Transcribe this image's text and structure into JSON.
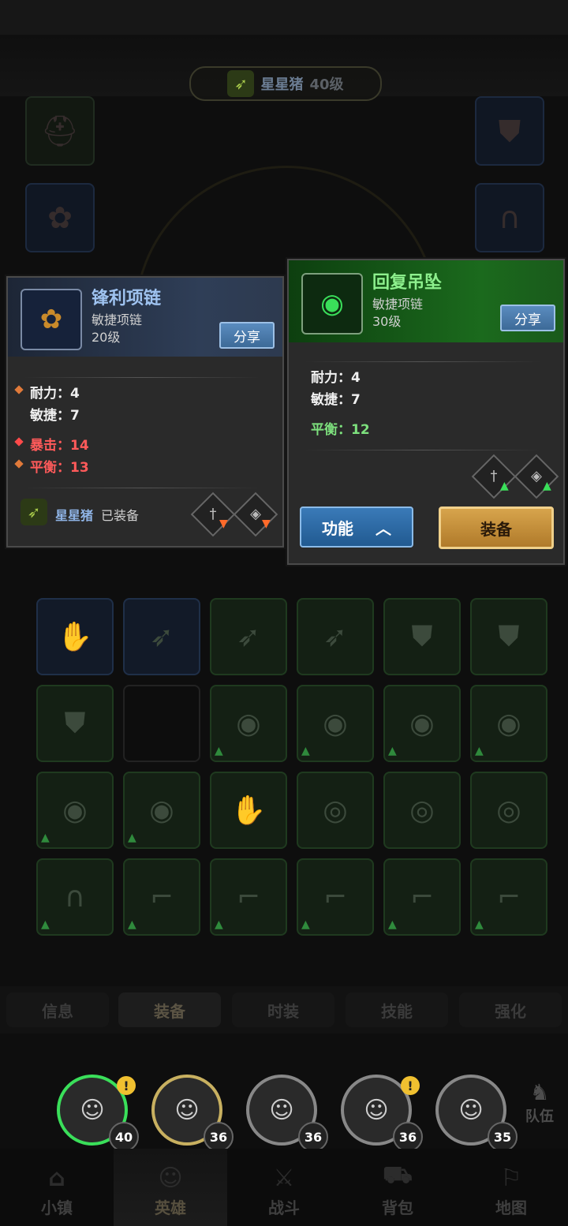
{
  "hero": {
    "name": "星星猪",
    "level": "40级"
  },
  "equipped_item": {
    "name": "锋利项链",
    "type": "敏捷项链",
    "level": "20级",
    "share_label": "分享",
    "stats": [
      {
        "label": "耐力：4"
      },
      {
        "label": "敏捷：7"
      }
    ],
    "bonus_stats": [
      {
        "label": "暴击：14"
      },
      {
        "label": "平衡：13"
      }
    ],
    "equipped_by": "星星猪",
    "equipped_status": "已装备"
  },
  "selected_item": {
    "name": "回复吊坠",
    "type": "敏捷项链",
    "level": "30级",
    "share_label": "分享",
    "stats": [
      {
        "label": "耐力：4"
      },
      {
        "label": "敏捷：7"
      }
    ],
    "bonus_stats": [
      {
        "label": "平衡：12"
      }
    ],
    "function_label": "功能",
    "equip_label": "装备"
  },
  "tabs": [
    {
      "label": "信息"
    },
    {
      "label": "装备"
    },
    {
      "label": "时装"
    },
    {
      "label": "技能"
    },
    {
      "label": "强化"
    }
  ],
  "heroes": [
    {
      "level": "40",
      "warn": "!"
    },
    {
      "level": "36"
    },
    {
      "level": "36"
    },
    {
      "level": "36",
      "warn": "!"
    },
    {
      "level": "35"
    }
  ],
  "team_label": "队伍",
  "nav": [
    {
      "label": "小镇"
    },
    {
      "label": "英雄"
    },
    {
      "label": "战斗"
    },
    {
      "label": "背包"
    },
    {
      "label": "地图"
    }
  ],
  "colors": {
    "accent_green": "#7de07d",
    "crit_red": "#ff5a5a",
    "item_green_header": "#1b6a1d",
    "item_blue_header": "#2f3e57",
    "equip_gold": "#d7a44c"
  }
}
